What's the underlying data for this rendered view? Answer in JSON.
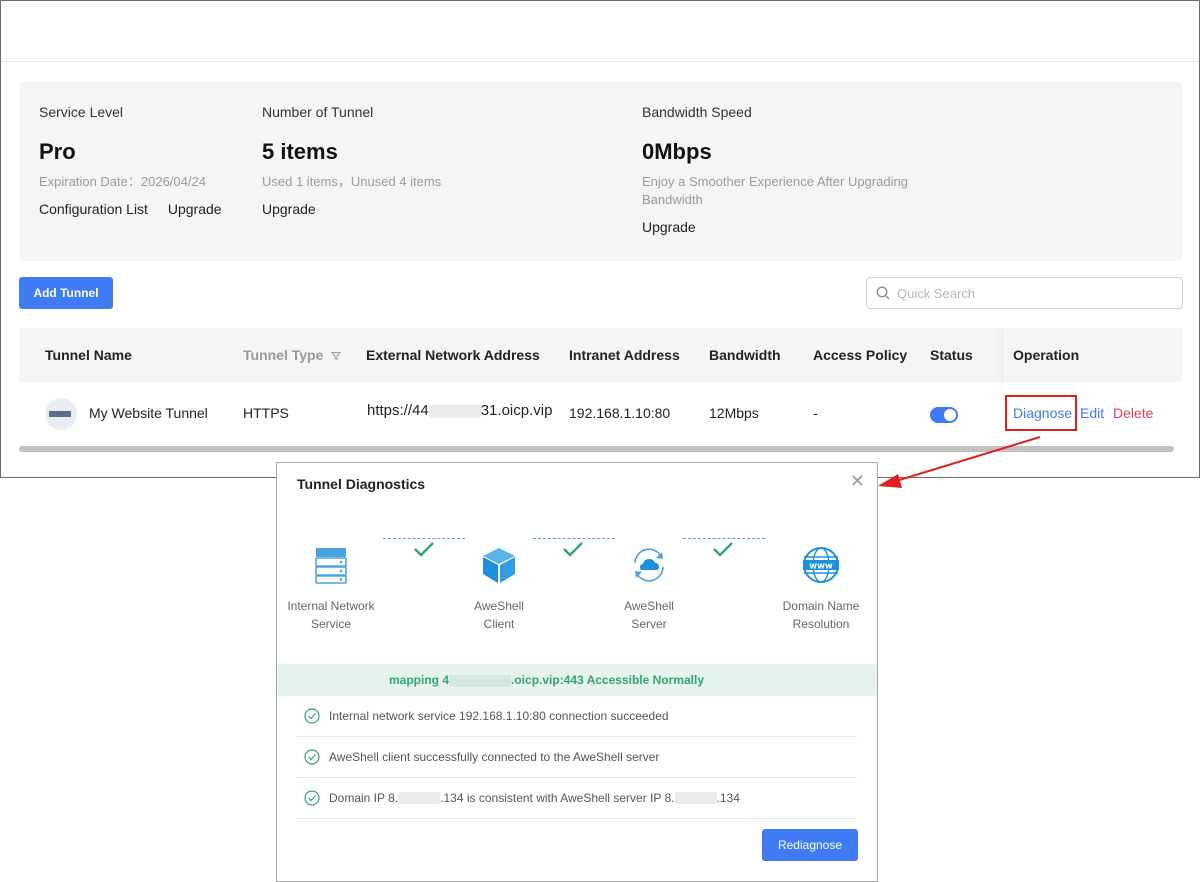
{
  "summary": {
    "service_level": {
      "label": "Service Level",
      "value": "Pro",
      "sub": "Expiration Date：2026/04/24",
      "links": [
        "Configuration List",
        "Upgrade"
      ]
    },
    "tunnels": {
      "label": "Number of Tunnel",
      "value": "5 items",
      "sub": "Used 1 items，Unused 4 items",
      "links": [
        "Upgrade"
      ]
    },
    "bandwidth": {
      "label": "Bandwidth Speed",
      "value": "0Mbps",
      "sub": "Enjoy a Smoother Experience After Upgrading Bandwidth",
      "links": [
        "Upgrade"
      ]
    }
  },
  "toolbar": {
    "add_label": "Add Tunnel",
    "search_placeholder": "Quick Search"
  },
  "table": {
    "headers": {
      "name": "Tunnel Name",
      "type": "Tunnel Type",
      "external": "External Network Address",
      "intranet": "Intranet Address",
      "bandwidth": "Bandwidth",
      "policy": "Access Policy",
      "status": "Status",
      "operation": "Operation"
    },
    "rows": [
      {
        "name": "My Website Tunnel",
        "type": "HTTPS",
        "external_prefix": "https://44",
        "external_suffix": "31.oicp.vip",
        "intranet": "192.168.1.10:80",
        "bandwidth": "12Mbps",
        "policy": "-",
        "status_on": true,
        "ops": {
          "diagnose": "Diagnose",
          "edit": "Edit",
          "delete": "Delete"
        }
      }
    ]
  },
  "dialog": {
    "title": "Tunnel Diagnostics",
    "steps": [
      {
        "label1": "Internal Network",
        "label2": "Service",
        "icon": "server-icon"
      },
      {
        "label1": "AweShell",
        "label2": "Client",
        "icon": "cube-icon"
      },
      {
        "label1": "AweShell",
        "label2": "Server",
        "icon": "cloud-sync-icon"
      },
      {
        "label1": "Domain Name",
        "label2": "Resolution",
        "icon": "www-globe-icon"
      }
    ],
    "result_prefix": "mapping 4",
    "result_suffix": ".oicp.vip:443 Accessible Normally",
    "checks": {
      "c1": "Internal network service 192.168.1.10:80 connection succeeded",
      "c2": "AweShell client successfully connected to the AweShell server",
      "c3_a": "Domain IP 8.",
      "c3_b": ".134 is consistent with AweShell server IP 8.",
      "c3_c": ".134"
    },
    "rediagnose_label": "Rediagnose"
  },
  "colors": {
    "accent": "#3e7bf5",
    "success": "#35a56d",
    "danger": "#e0405a",
    "highlight": "#e02020"
  }
}
